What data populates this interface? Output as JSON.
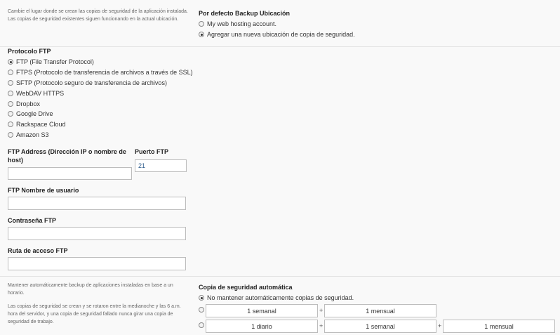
{
  "location_note": [
    "Cambie el lugar donde se crean las copias de seguridad de la aplicación instalada.",
    "Las copias de seguridad existentes siguen funcionando en la actual ubicación."
  ],
  "default_location": {
    "heading": "Por defecto Backup Ubicación",
    "options": [
      {
        "label": "My web hosting account.",
        "checked": false
      },
      {
        "label": "Agregar una nueva ubicación de copia de seguridad.",
        "checked": true
      }
    ]
  },
  "protocol": {
    "heading": "Protocolo FTP",
    "options": [
      {
        "label": "FTP (File Transfer Protocol)",
        "checked": true
      },
      {
        "label": "FTPS (Protocolo de transferencia de archivos a través de SSL)",
        "checked": false
      },
      {
        "label": "SFTP (Protocolo seguro de transferencia de archivos)",
        "checked": false
      },
      {
        "label": "WebDAV HTTPS",
        "checked": false
      },
      {
        "label": "Dropbox",
        "checked": false
      },
      {
        "label": "Google Drive",
        "checked": false
      },
      {
        "label": "Rackspace Cloud",
        "checked": false
      },
      {
        "label": "Amazon S3",
        "checked": false
      }
    ]
  },
  "form": {
    "ftp_address_label_1": "FTP Address (Dirección IP o nombre de",
    "ftp_address_label_2": "host)",
    "ftp_address_value": "",
    "port_label": "Puerto FTP",
    "port_value": "21",
    "username_label": "FTP Nombre de usuario",
    "username_value": "",
    "password_label": "Contraseña FTP",
    "password_value": "",
    "path_label": "Ruta de acceso FTP",
    "path_value": ""
  },
  "auto_note": {
    "p1_line1": "Mantener automáticamente backup de aplicaciones instaladas en base a un",
    "p1_line2": "horario.",
    "p2_line1": "Las copias de seguridad se crean y se rotaron entre la medianoche y las 6 a.m.",
    "p2_line2": "hora del servidor, y una copia de seguridad fallado nunca girar una copia de",
    "p2_line3": "seguridad de trabajo."
  },
  "auto_backup": {
    "heading": "Copia de seguridad automática",
    "none_label": "No mantener automáticamente copias de seguridad.",
    "row1": [
      "1 semanal",
      "1 mensual"
    ],
    "row2": [
      "1 diario",
      "1 semanal",
      "1 mensual"
    ],
    "plus": "+"
  }
}
